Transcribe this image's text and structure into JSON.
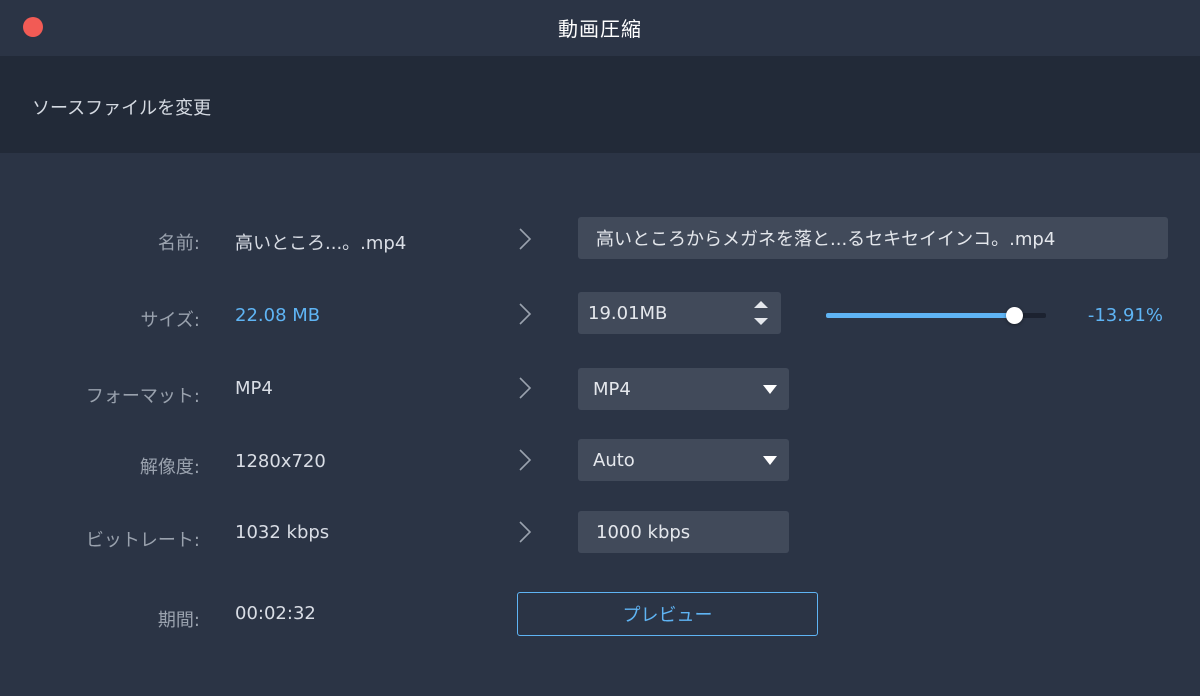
{
  "window": {
    "title": "動画圧縮"
  },
  "source": {
    "change_label": "ソースファイルを変更"
  },
  "rows": {
    "name": {
      "label": "名前:",
      "original": "高いところ...。.mp4",
      "output": "高いところからメガネを落と...るセキセイインコ。.mp4"
    },
    "size": {
      "label": "サイズ:",
      "original": "22.08 MB",
      "output": "19.01MB",
      "percent": "-13.91%",
      "slider_fraction": 0.86
    },
    "format": {
      "label": "フォーマット:",
      "original": "MP4",
      "selected": "MP4"
    },
    "resolution": {
      "label": "解像度:",
      "original": "1280x720",
      "selected": "Auto"
    },
    "bitrate": {
      "label": "ビットレート:",
      "original": "1032 kbps",
      "output": "1000 kbps"
    },
    "duration": {
      "label": "期間:",
      "value": "00:02:32"
    }
  },
  "preview": {
    "label": "プレビュー"
  },
  "colors": {
    "accent": "#5fb4f4",
    "close": "#f25b55",
    "background": "#2b3445",
    "source_bar": "#222a38",
    "field": "#414a5a"
  },
  "icons": {
    "close": "close-icon",
    "chevron": "chevron-right-icon",
    "stepper": "stepper-icon",
    "caret": "caret-down-icon"
  }
}
